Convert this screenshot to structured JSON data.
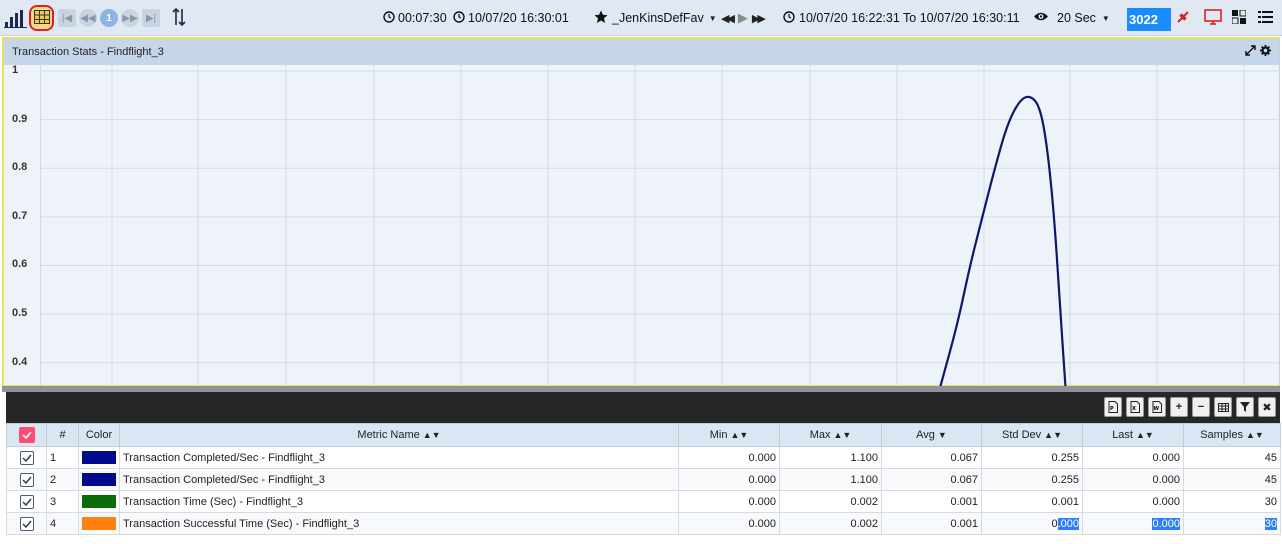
{
  "toolbar": {
    "elapsed": "00:07:30",
    "current_time": "10/07/20 16:30:01",
    "favorite": "_JenKinsDefFav",
    "time_range": "10/07/20 16:22:31 To 10/07/20 16:30:11",
    "interval": "20 Sec",
    "session_id": "3022",
    "page_number": "1"
  },
  "panel": {
    "title": "Transaction Stats - Findflight_3"
  },
  "chart_data": {
    "type": "line",
    "title": "Transaction Stats - Findflight_3",
    "y_ticks": [
      "1",
      "0.9",
      "0.8",
      "0.7",
      "0.6",
      "0.5",
      "0.4"
    ],
    "ylim": [
      0.35,
      1
    ],
    "grid": true,
    "series": [
      {
        "color": "#0f1670",
        "points": [
          [
            0.726,
            0.35
          ],
          [
            0.74,
            0.48
          ],
          [
            0.75,
            0.6
          ],
          [
            0.76,
            0.7
          ],
          [
            0.77,
            0.8
          ],
          [
            0.78,
            0.89
          ],
          [
            0.79,
            0.94
          ],
          [
            0.798,
            0.95
          ],
          [
            0.806,
            0.93
          ],
          [
            0.812,
            0.85
          ],
          [
            0.818,
            0.7
          ],
          [
            0.823,
            0.5
          ],
          [
            0.827,
            0.35
          ]
        ]
      }
    ]
  },
  "table": {
    "headers": {
      "num": "#",
      "color": "Color",
      "metric": "Metric Name",
      "min": "Min",
      "max": "Max",
      "avg": "Avg",
      "std": "Std Dev",
      "last": "Last",
      "samples": "Samples"
    },
    "rows": [
      {
        "num": "1",
        "color": "#000a8c",
        "metric": "Transaction Completed/Sec - Findflight_3",
        "min": "0.000",
        "max": "1.100",
        "avg": "0.067",
        "std": "0.255",
        "last": "0.000",
        "samples": "45"
      },
      {
        "num": "2",
        "color": "#000a8c",
        "metric": "Transaction Completed/Sec - Findflight_3",
        "min": "0.000",
        "max": "1.100",
        "avg": "0.067",
        "std": "0.255",
        "last": "0.000",
        "samples": "45"
      },
      {
        "num": "3",
        "color": "#0a6d0a",
        "metric": "Transaction Time (Sec) - Findflight_3",
        "min": "0.000",
        "max": "0.002",
        "avg": "0.001",
        "std": "0.001",
        "last": "0.000",
        "samples": "30"
      },
      {
        "num": "4",
        "color": "#ff7f11",
        "metric": "Transaction Successful Time (Sec) - Findflight_3",
        "min": "0.000",
        "max": "0.002",
        "avg": "0.001",
        "std_prefix": "0",
        "std_selected": ".000",
        "last": "0.000",
        "samples": "30"
      }
    ]
  }
}
